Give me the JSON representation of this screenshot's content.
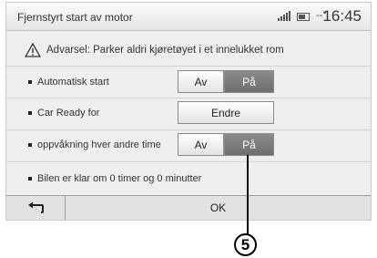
{
  "header": {
    "title": "Fjernstyrt start av motor",
    "signal_icon": "signal-bars-icon",
    "battery_icon": "battery-icon",
    "temperature": "--°",
    "time": "16:45"
  },
  "warning": {
    "icon": "warning-triangle-icon",
    "text": "Advarsel: Parker aldri kjøretøyet i et innelukket rom"
  },
  "settings": [
    {
      "label": "Automatisk start",
      "off": "Av",
      "on": "På",
      "selected": "on"
    },
    {
      "label": "Car Ready for",
      "button": "Endre"
    },
    {
      "label": "oppvåkning hver andre time",
      "off": "Av",
      "on": "På",
      "selected": "on"
    },
    {
      "label": "Bilen er klar om 0 timer og 0 minutter"
    }
  ],
  "footer": {
    "back_icon": "back-arrow-icon",
    "ok": "OK"
  },
  "callout": {
    "number": "5"
  },
  "colors": {
    "selected": "#7a7a7a",
    "background": "#efefef"
  }
}
